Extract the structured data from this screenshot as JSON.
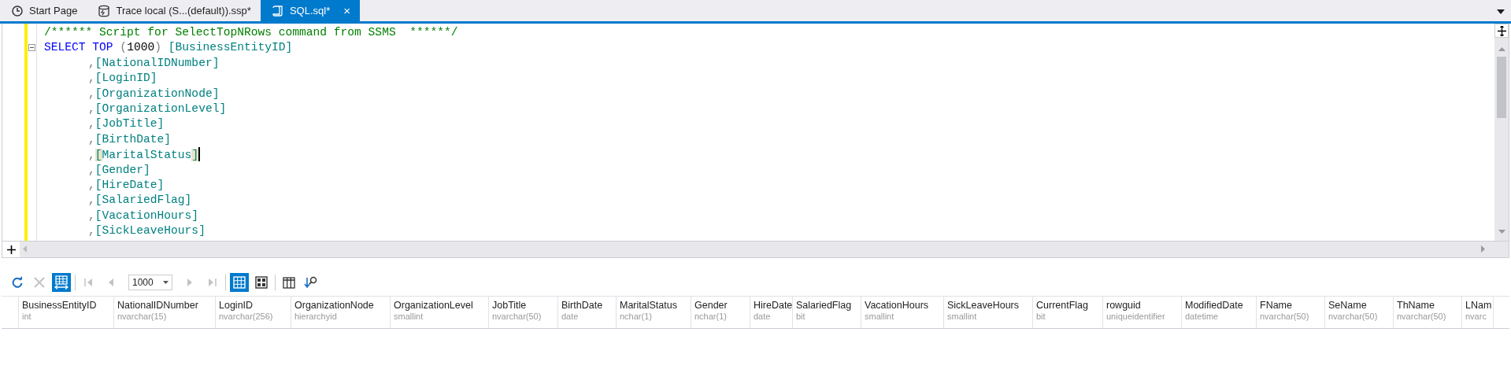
{
  "tabs": [
    {
      "kind": "start",
      "label": "Start Page",
      "selected": false,
      "closable": false
    },
    {
      "kind": "trace",
      "label": "Trace local (S...(default)).ssp*",
      "selected": false,
      "closable": false
    },
    {
      "kind": "sql",
      "label": "SQL.sql*",
      "selected": true,
      "closable": true,
      "close": "×"
    }
  ],
  "editor": {
    "lines": [
      {
        "kind": "top",
        "fold": false,
        "caret": false,
        "tokens": [
          {
            "kind": "comment",
            "text": "/****** Script for SelectTopNRows command from SSMS  ******/"
          }
        ]
      },
      {
        "kind": "top",
        "fold": true,
        "caret": false,
        "tokens": [
          {
            "kind": "keyword",
            "text": "SELECT"
          },
          {
            "kind": "keyword",
            "text": "TOP"
          },
          {
            "kind": "paren-open",
            "text": "("
          },
          {
            "kind": "number",
            "text": "1000"
          },
          {
            "kind": "paren-close",
            "text": ")"
          },
          {
            "kind": "ident",
            "text": "[BusinessEntityID]"
          }
        ]
      },
      {
        "kind": "continuation",
        "fold": false,
        "caret": false,
        "tokens": [
          {
            "kind": "punct",
            "text": ","
          },
          {
            "kind": "ident",
            "text": "[NationalIDNumber]"
          }
        ]
      },
      {
        "kind": "continuation",
        "fold": false,
        "caret": false,
        "tokens": [
          {
            "kind": "punct",
            "text": ","
          },
          {
            "kind": "ident",
            "text": "[LoginID]"
          }
        ]
      },
      {
        "kind": "continuation",
        "fold": false,
        "caret": false,
        "tokens": [
          {
            "kind": "punct",
            "text": ","
          },
          {
            "kind": "ident",
            "text": "[OrganizationNode]"
          }
        ]
      },
      {
        "kind": "continuation",
        "fold": false,
        "caret": false,
        "tokens": [
          {
            "kind": "punct",
            "text": ","
          },
          {
            "kind": "ident",
            "text": "[OrganizationLevel]"
          }
        ]
      },
      {
        "kind": "continuation",
        "fold": false,
        "caret": false,
        "tokens": [
          {
            "kind": "punct",
            "text": ","
          },
          {
            "kind": "ident",
            "text": "[JobTitle]"
          }
        ]
      },
      {
        "kind": "continuation",
        "fold": false,
        "caret": false,
        "tokens": [
          {
            "kind": "punct",
            "text": ","
          },
          {
            "kind": "ident",
            "text": "[BirthDate]"
          }
        ]
      },
      {
        "kind": "continuation",
        "fold": false,
        "caret": true,
        "tokens": [
          {
            "kind": "punct",
            "text": ","
          },
          {
            "kind": "bracket",
            "highlight": true,
            "text": "["
          },
          {
            "kind": "ident",
            "text": "MaritalStatus"
          },
          {
            "kind": "bracket",
            "highlight": true,
            "text": "]"
          }
        ]
      },
      {
        "kind": "continuation",
        "fold": false,
        "caret": false,
        "tokens": [
          {
            "kind": "punct",
            "text": ","
          },
          {
            "kind": "ident",
            "text": "[Gender]"
          }
        ]
      },
      {
        "kind": "continuation",
        "fold": false,
        "caret": false,
        "tokens": [
          {
            "kind": "punct",
            "text": ","
          },
          {
            "kind": "ident",
            "text": "[HireDate]"
          }
        ]
      },
      {
        "kind": "continuation",
        "fold": false,
        "caret": false,
        "tokens": [
          {
            "kind": "punct",
            "text": ","
          },
          {
            "kind": "ident",
            "text": "[SalariedFlag]"
          }
        ]
      },
      {
        "kind": "continuation",
        "fold": false,
        "caret": false,
        "tokens": [
          {
            "kind": "punct",
            "text": ","
          },
          {
            "kind": "ident",
            "text": "[VacationHours]"
          }
        ]
      },
      {
        "kind": "continuation",
        "fold": false,
        "caret": false,
        "tokens": [
          {
            "kind": "punct",
            "text": ","
          },
          {
            "kind": "ident",
            "text": "[SickLeaveHours]"
          }
        ]
      }
    ]
  },
  "toolbar": [
    {
      "kind": "refresh",
      "disabled": false,
      "selected": false
    },
    {
      "kind": "cancel",
      "disabled": true,
      "selected": false
    },
    {
      "kind": "grid-toggle",
      "disabled": false,
      "selected": true
    },
    {
      "kind": "sep"
    },
    {
      "kind": "first",
      "disabled": true,
      "selected": false
    },
    {
      "kind": "prev",
      "disabled": true,
      "selected": false
    },
    {
      "kind": "combo",
      "value": "1000"
    },
    {
      "kind": "next",
      "disabled": true,
      "selected": false
    },
    {
      "kind": "last",
      "disabled": true,
      "selected": false
    },
    {
      "kind": "sep"
    },
    {
      "kind": "grid-view",
      "disabled": false,
      "selected": true
    },
    {
      "kind": "card-view",
      "disabled": false,
      "selected": false
    },
    {
      "kind": "sep"
    },
    {
      "kind": "columns",
      "disabled": false,
      "selected": false
    },
    {
      "kind": "find",
      "disabled": false,
      "selected": false
    }
  ],
  "grid": {
    "columns": [
      {
        "name": "BusinessEntityID",
        "type": "int"
      },
      {
        "name": "NationalIDNumber",
        "type": "nvarchar(15)"
      },
      {
        "name": "LoginID",
        "type": "nvarchar(256)"
      },
      {
        "name": "OrganizationNode",
        "type": "hierarchyid"
      },
      {
        "name": "OrganizationLevel",
        "type": "smallint"
      },
      {
        "name": "JobTitle",
        "type": "nvarchar(50)"
      },
      {
        "name": "BirthDate",
        "type": "date"
      },
      {
        "name": "MaritalStatus",
        "type": "nchar(1)"
      },
      {
        "name": "Gender",
        "type": "nchar(1)"
      },
      {
        "name": "HireDate",
        "type": "date"
      },
      {
        "name": "SalariedFlag",
        "type": "bit"
      },
      {
        "name": "VacationHours",
        "type": "smallint"
      },
      {
        "name": "SickLeaveHours",
        "type": "smallint"
      },
      {
        "name": "CurrentFlag",
        "type": "bit"
      },
      {
        "name": "rowguid",
        "type": "uniqueidentifier"
      },
      {
        "name": "ModifiedDate",
        "type": "datetime"
      },
      {
        "name": "FName",
        "type": "nvarchar(50)"
      },
      {
        "name": "SeName",
        "type": "nvarchar(50)"
      },
      {
        "name": "ThName",
        "type": "nvarchar(50)"
      },
      {
        "name": "LNam",
        "type": "nvarc"
      }
    ]
  }
}
